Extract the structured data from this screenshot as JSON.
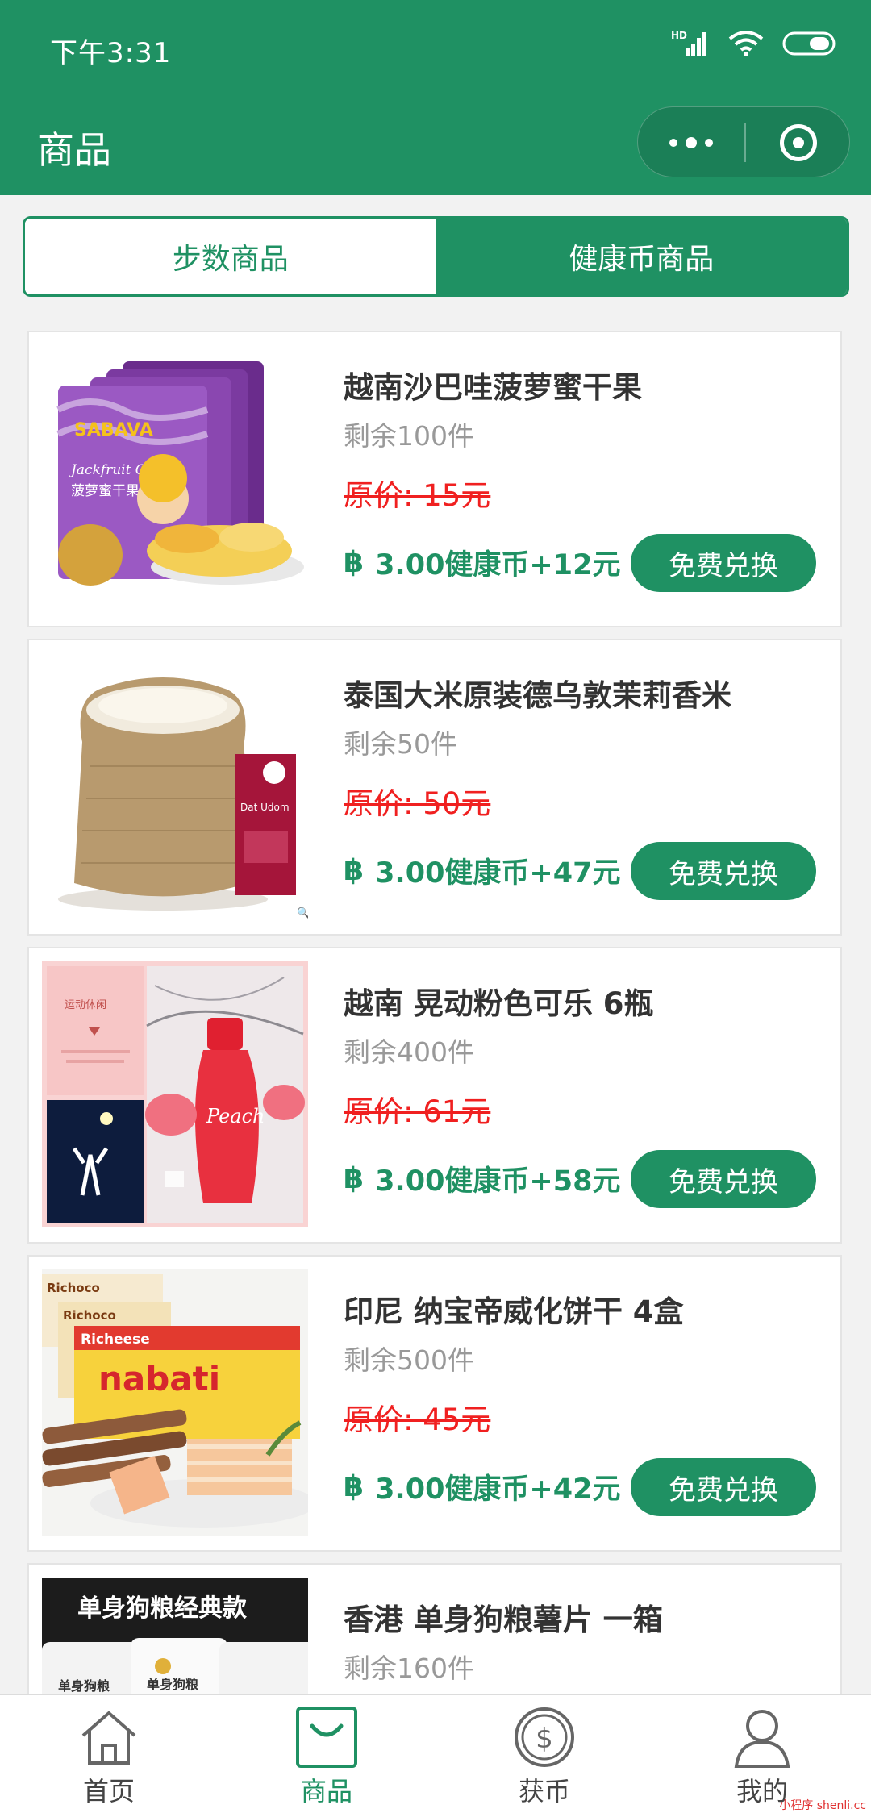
{
  "status_bar": {
    "time": "下午3:31",
    "network_label": "HD"
  },
  "nav": {
    "title": "商品"
  },
  "tabs": [
    {
      "label": "步数商品",
      "active": false
    },
    {
      "label": "健康币商品",
      "active": true
    }
  ],
  "coin_symbol": "฿",
  "products": [
    {
      "name": "越南沙巴哇菠萝蜜干果",
      "stock": "剩余100件",
      "original_price": "原价: 15元",
      "price": "3.00健康币+12元",
      "button": "免费兑换",
      "image": "jackfruit-chips"
    },
    {
      "name": "泰国大米原装德乌敦茉莉香米",
      "stock": "剩余50件",
      "original_price": "原价: 50元",
      "price": "3.00健康币+47元",
      "button": "免费兑换",
      "image": "rice-sack"
    },
    {
      "name": "越南 晃动粉色可乐 6瓶",
      "stock": "剩余400件",
      "original_price": "原价: 61元",
      "price": "3.00健康币+58元",
      "button": "免费兑换",
      "image": "pink-cola"
    },
    {
      "name": "印尼 纳宝帝威化饼干 4盒",
      "stock": "剩余500件",
      "original_price": "原价: 45元",
      "price": "3.00健康币+42元",
      "button": "免费兑换",
      "image": "nabati-wafers"
    },
    {
      "name": "香港 单身狗粮薯片 一箱",
      "stock": "剩余160件",
      "original_price": "",
      "price": "",
      "button": "",
      "image": "single-dog-chips"
    }
  ],
  "image_text": {
    "jackfruit": {
      "brand": "SABAVA",
      "en": "Jackfruit Chips",
      "cn": "菠萝蜜干果"
    },
    "rice": {
      "label": "Dat Udom"
    },
    "cola": {
      "tag": "运动休闲",
      "bottle": "Peach"
    },
    "wafer": {
      "brand1": "Richoco",
      "brand2": "Richeese",
      "brand3": "nabati"
    },
    "chips": {
      "banner": "单身狗粮经典款",
      "pack": "单身狗粮"
    }
  },
  "tabbar": [
    {
      "label": "首页",
      "icon": "home-icon",
      "active": false
    },
    {
      "label": "商品",
      "icon": "shopping-bag-icon",
      "active": true
    },
    {
      "label": "获币",
      "icon": "coin-icon",
      "active": false
    },
    {
      "label": "我的",
      "icon": "user-icon",
      "active": false
    }
  ],
  "watermark": "小程序 shenli.cc",
  "colors": {
    "primary": "#1f9163",
    "strike_red": "#f02020",
    "background": "#f2f2f2"
  }
}
